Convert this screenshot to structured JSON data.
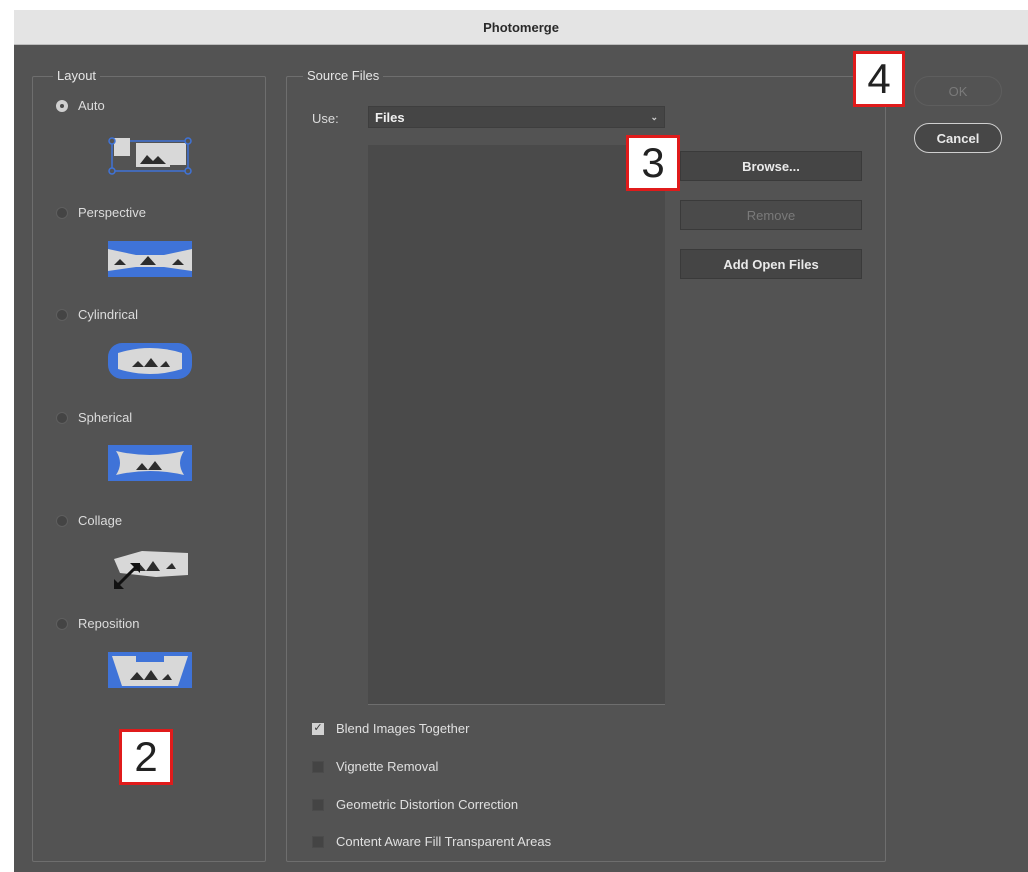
{
  "window": {
    "title": "Photomerge"
  },
  "layout_group": {
    "legend": "Layout",
    "options": [
      {
        "label": "Auto",
        "selected": true,
        "icon": "auto-layout-icon"
      },
      {
        "label": "Perspective",
        "selected": false,
        "icon": "perspective-layout-icon"
      },
      {
        "label": "Cylindrical",
        "selected": false,
        "icon": "cylindrical-layout-icon"
      },
      {
        "label": "Spherical",
        "selected": false,
        "icon": "spherical-layout-icon"
      },
      {
        "label": "Collage",
        "selected": false,
        "icon": "collage-layout-icon"
      },
      {
        "label": "Reposition",
        "selected": false,
        "icon": "reposition-layout-icon"
      }
    ]
  },
  "source_files": {
    "legend": "Source Files",
    "use_label": "Use:",
    "use_value": "Files",
    "buttons": {
      "browse": "Browse...",
      "remove": "Remove",
      "add_open": "Add Open Files"
    }
  },
  "options": [
    {
      "label": "Blend Images Together",
      "checked": true
    },
    {
      "label": "Vignette Removal",
      "checked": false
    },
    {
      "label": "Geometric Distortion Correction",
      "checked": false
    },
    {
      "label": "Content Aware Fill Transparent Areas",
      "checked": false
    }
  ],
  "dialog_buttons": {
    "ok": "OK",
    "cancel": "Cancel"
  },
  "annotations": {
    "m2": "2",
    "m3": "3",
    "m4": "4"
  },
  "colors": {
    "accent_blue": "#3f73d8",
    "panel": "#535353"
  }
}
